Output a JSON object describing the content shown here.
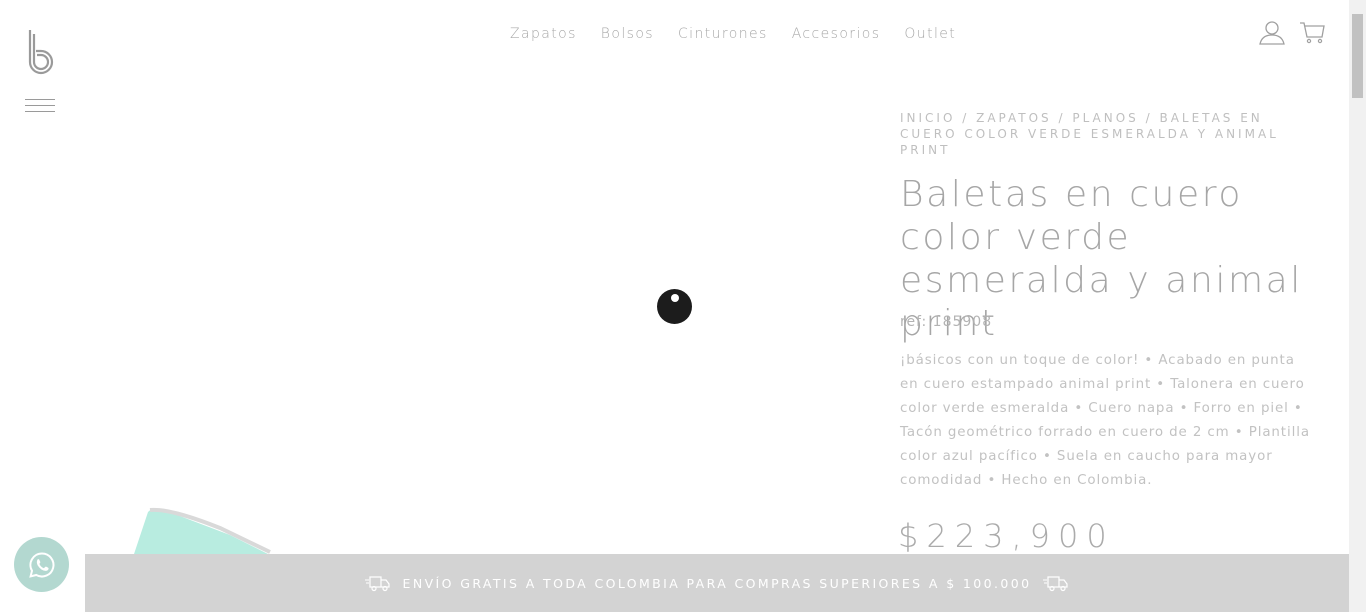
{
  "brand": {
    "logo_icon": "bosi-logo-icon"
  },
  "nav": {
    "items": [
      {
        "label": "Zapatos"
      },
      {
        "label": "Bolsos"
      },
      {
        "label": "Cinturones"
      },
      {
        "label": "Accesorios"
      },
      {
        "label": "Outlet"
      }
    ]
  },
  "header_icons": {
    "user": "user-icon",
    "cart": "cart-icon",
    "menu": "hamburger-icon"
  },
  "breadcrumb": {
    "items": [
      "Inicio",
      "Zapatos",
      "Planos",
      "Baletas en cuero color verde esmeralda y animal print"
    ],
    "separator": " / "
  },
  "product": {
    "title": "Baletas en cuero color verde esmeralda y animal print",
    "ref": "ref: 185908",
    "description": "¡básicos con un toque de color! • Acabado en punta en cuero estampado animal print • Talonera en cuero color verde esmeralda • Cuero napa • Forro en piel • Tacón geométrico forrado en cuero de 2 cm • Plantilla color azul pacífico • Suela en caucho para mayor comodidad • Hecho en Colombia.",
    "price": "$223,900"
  },
  "shipping_banner": {
    "text": "Envío gratis a toda Colombia para compras superiores a $ 100.000",
    "icon": "truck-icon"
  },
  "whatsapp": {
    "icon": "whatsapp-icon"
  },
  "colors": {
    "banner_bg": "#d3d3d3",
    "whatsapp_bg": "#b3d8d0",
    "text_muted": "#a8a8a8",
    "product_mint": "#b8ece0"
  }
}
